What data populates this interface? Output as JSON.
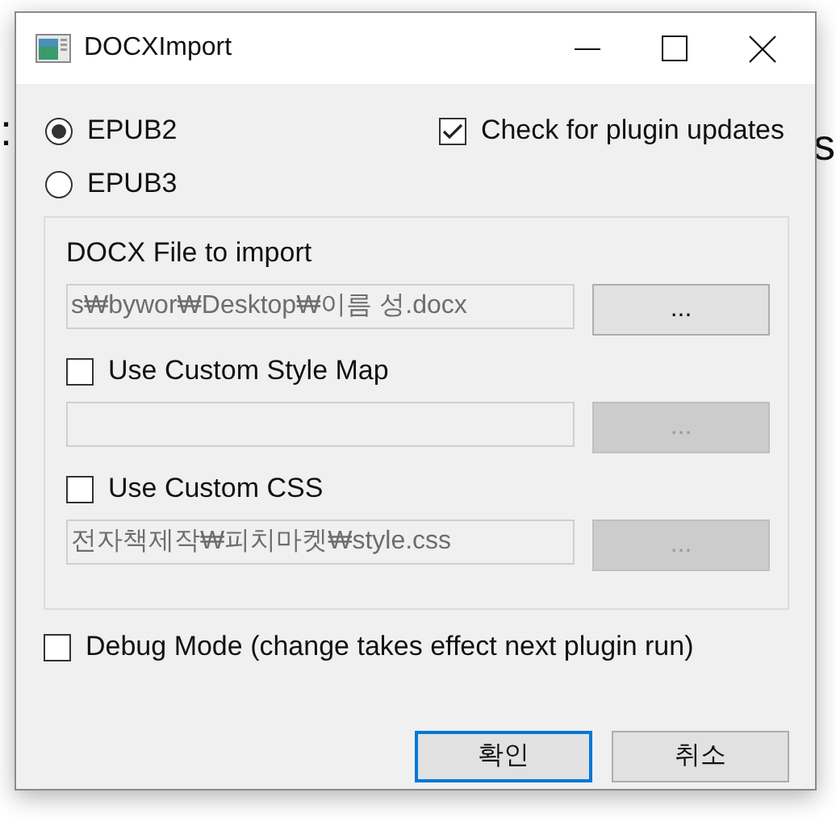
{
  "background_texts": [
    ":",
    "s"
  ],
  "window": {
    "title": "DOCXImport"
  },
  "format_options": [
    {
      "label": "EPUB2",
      "selected": true
    },
    {
      "label": "EPUB3",
      "selected": false
    }
  ],
  "plugin_updates": {
    "label": "Check for plugin updates",
    "checked": true
  },
  "group": {
    "file_label": "DOCX File to import",
    "file_field": {
      "value": "s₩bywor₩Desktop₩이름 성.docx",
      "disabled": true
    },
    "file_button": {
      "label": "...",
      "disabled": false
    },
    "style_map": {
      "label": "Use Custom Style Map",
      "checked": false
    },
    "style_field": {
      "disabled": true
    },
    "style_button": {
      "label": "...",
      "disabled": true
    },
    "custom_css": {
      "label": "Use Custom CSS",
      "checked": false
    },
    "css_field": {
      "value": "전자책제작₩피치마켓₩style.css",
      "disabled": true
    },
    "css_button": {
      "label": "...",
      "disabled": true
    }
  },
  "debug_mode": {
    "label": "Debug Mode (change takes effect next plugin run)",
    "checked": false
  },
  "buttons": [
    {
      "label": "확인",
      "focused": true
    },
    {
      "label": "취소",
      "focused": false
    }
  ]
}
